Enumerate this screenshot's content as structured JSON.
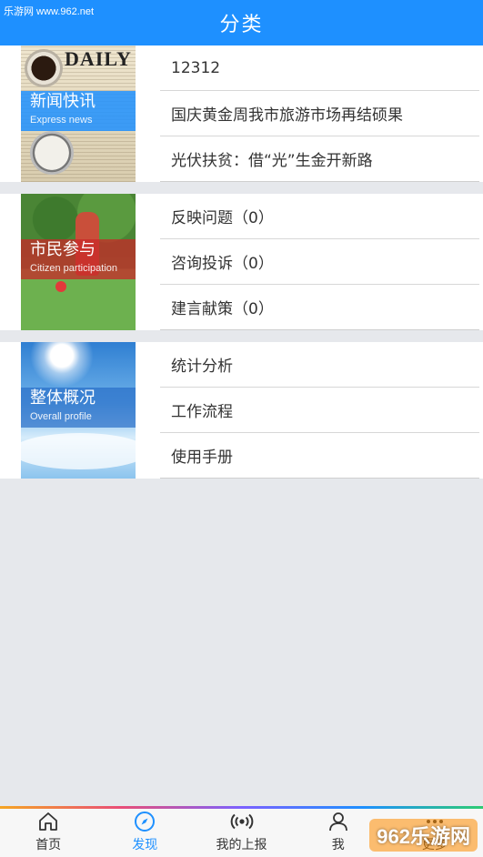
{
  "watermark": "乐游网 www.962.net",
  "header": {
    "title": "分类"
  },
  "sections": [
    {
      "thumb": {
        "title": "新闻快讯",
        "subtitle": "Express news",
        "masthead": "DAILY"
      },
      "items": [
        "12312",
        "国庆黄金周我市旅游市场再结硕果",
        "光伏扶贫：借“光”生金开新路"
      ]
    },
    {
      "thumb": {
        "title": "市民参与",
        "subtitle": "Citizen participation"
      },
      "items": [
        "反映问题（0）",
        "咨询投诉（0）",
        "建言献策（0）"
      ]
    },
    {
      "thumb": {
        "title": "整体概况",
        "subtitle": "Overall profile"
      },
      "items": [
        "统计分析",
        "工作流程",
        "使用手册"
      ]
    }
  ],
  "tabbar": {
    "tabs": [
      {
        "label": "首页",
        "icon": "home-icon"
      },
      {
        "label": "发现",
        "icon": "compass-icon",
        "active": true
      },
      {
        "label": "我的上报",
        "icon": "broadcast-icon"
      },
      {
        "label": "我",
        "icon": "user-icon"
      },
      {
        "label": "更多",
        "icon": "more-icon"
      }
    ]
  },
  "watermark_logo": "962乐游网",
  "colors": {
    "accent": "#1e90ff",
    "background": "#e6e8ec"
  }
}
